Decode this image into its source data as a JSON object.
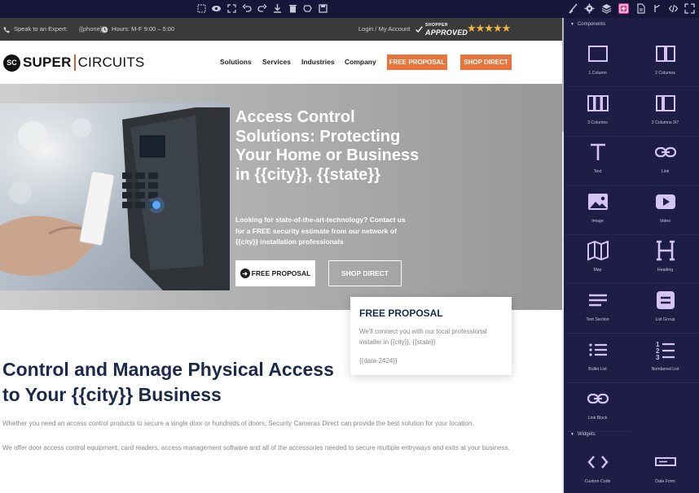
{
  "toolbar": {
    "left_icons": [
      "square-select-icon",
      "eye-icon",
      "fullscreen-icon",
      "undo-icon",
      "redo-icon",
      "download-icon",
      "trash-icon",
      "blob-icon",
      "save-icon"
    ],
    "right_icons": [
      "brush-icon",
      "gear-icon",
      "layers-icon",
      "plus-square-icon",
      "file-icon",
      "branch-icon",
      "code-icon",
      "expand-icon"
    ],
    "active_right": "plus-square-icon"
  },
  "site": {
    "topbar": {
      "expert_label": "Speak to an Expert:",
      "phone": "{{phone}}",
      "hours": "Hours: M-F 9:00 – 5:00",
      "login": "Login / My Account",
      "approved_top": "SHOPPER",
      "approved_main": "APPROVED",
      "stars": "★★★★★"
    },
    "nav": {
      "brand_mark": "SC",
      "brand_word1": "SUPER",
      "brand_word2": "CIRCUITS",
      "links": [
        "Solutions",
        "Services",
        "Industries",
        "Company"
      ],
      "btn_proposal": "FREE PROPOSAL",
      "btn_shop": "SHOP DIRECT"
    },
    "hero": {
      "title": "Access Control Solutions: Protecting Your Home or Business in {{city}}, {{state}}",
      "subtitle": "Looking for state-of-the-art-technology? Contact us for a FREE security estimate from our network of {{city}} installation professionals",
      "btn_proposal": "FREE PROPOSAL",
      "btn_shop": "SHOP DIRECT"
    },
    "card": {
      "heading": "FREE PROPOSAL",
      "text": "We'll connect you with our local professional installer in {{city}}, {{state}}",
      "data": "{{data-2424}}"
    },
    "body": {
      "heading": "Control and Manage Physical Access to Your {{city}} Business",
      "para1": "Whether you need an access control products to secure a single door or hundreds of doors, Security Cameras Direct can provide the best solution for your location.",
      "para2": "We offer door access control equipment, card readers, access management software and all of the accessories needed to secure multiple entryways and exits at your business."
    }
  },
  "panel": {
    "components_title": "Components",
    "widgets_title": "Widgets",
    "components": [
      {
        "label": "1 Column",
        "icon": "one-column-icon"
      },
      {
        "label": "2 Columns",
        "icon": "two-columns-icon"
      },
      {
        "label": "3 Columns",
        "icon": "three-columns-icon"
      },
      {
        "label": "2 Columns 3/7",
        "icon": "two-columns-37-icon"
      },
      {
        "label": "Text",
        "icon": "text-icon"
      },
      {
        "label": "Link",
        "icon": "link-icon"
      },
      {
        "label": "Image",
        "icon": "image-icon"
      },
      {
        "label": "Video",
        "icon": "video-icon"
      },
      {
        "label": "Map",
        "icon": "map-icon"
      },
      {
        "label": "Heading",
        "icon": "heading-icon"
      },
      {
        "label": "Text Section",
        "icon": "text-section-icon"
      },
      {
        "label": "List Group",
        "icon": "list-group-icon"
      },
      {
        "label": "Bullet List",
        "icon": "bullet-list-icon"
      },
      {
        "label": "Numbered List",
        "icon": "numbered-list-icon"
      },
      {
        "label": "Link Block",
        "icon": "link-block-icon"
      }
    ],
    "widgets": [
      {
        "label": "Custom Code",
        "icon": "custom-code-icon"
      },
      {
        "label": "Data Form",
        "icon": "data-form-icon"
      }
    ]
  }
}
